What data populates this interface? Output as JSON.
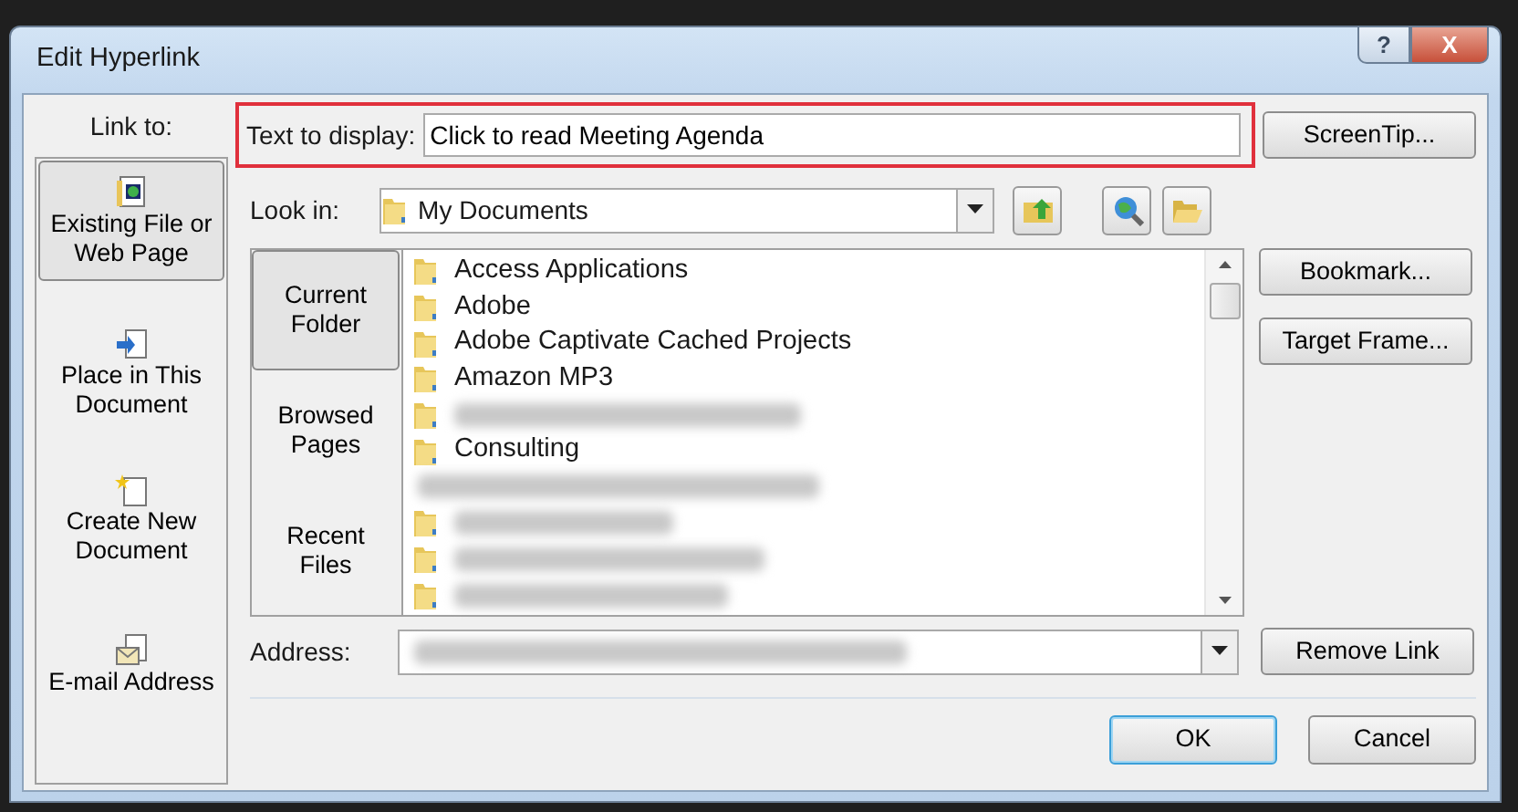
{
  "window": {
    "title": "Edit Hyperlink",
    "title_buttons": [
      {
        "kind": "help",
        "label": "?"
      },
      {
        "kind": "close",
        "label": "X"
      }
    ]
  },
  "link_to": {
    "label": "Link to:",
    "items": [
      {
        "kind": "file",
        "label": "Existing File or Web Page",
        "selected": true
      },
      {
        "kind": "place",
        "label": "Place in This Document",
        "selected": false
      },
      {
        "kind": "new",
        "label": "Create New Document",
        "selected": false
      },
      {
        "kind": "email",
        "label": "E-mail Address",
        "selected": false
      }
    ]
  },
  "text_to_display": {
    "label": "Text to display:",
    "value": "Click to read Meeting Agenda",
    "highlighted": true
  },
  "look_in": {
    "label": "Look in:",
    "value": "My Documents"
  },
  "browse_tabs": [
    {
      "label": "Current Folder",
      "selected": true
    },
    {
      "label": "Browsed Pages",
      "selected": false
    },
    {
      "label": "Recent Files",
      "selected": false
    }
  ],
  "files": [
    {
      "kind": "folder",
      "name": "Access Applications"
    },
    {
      "kind": "folder",
      "name": "Adobe"
    },
    {
      "kind": "folder",
      "name": "Adobe Captivate Cached Projects"
    },
    {
      "kind": "folder",
      "name": "Amazon MP3"
    },
    {
      "kind": "blurred_folder"
    },
    {
      "kind": "folder",
      "name": "Consulting"
    },
    {
      "kind": "blurred_line"
    },
    {
      "kind": "blurred_folder"
    },
    {
      "kind": "blurred_folder"
    },
    {
      "kind": "blurred_folder"
    }
  ],
  "address": {
    "label": "Address:"
  },
  "side_buttons": [
    {
      "label": "ScreenTip..."
    },
    {
      "label": "Bookmark..."
    },
    {
      "label": "Target Frame..."
    },
    {
      "label": "Remove Link"
    }
  ],
  "footer_buttons": [
    {
      "label": "OK",
      "default": true
    },
    {
      "label": "Cancel",
      "default": false
    }
  ]
}
